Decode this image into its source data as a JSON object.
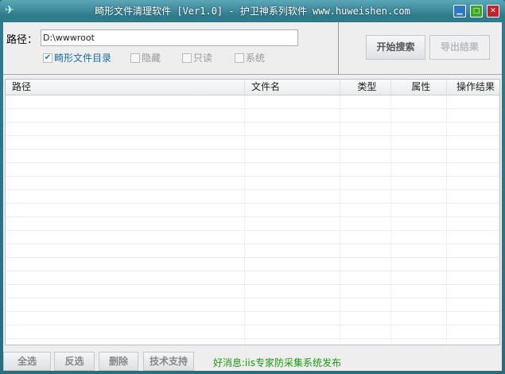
{
  "window": {
    "title": "畸形文件清理软件 [Ver1.0] - 护卫神系列软件 www.huweishen.com",
    "icon": "bird-logo-icon",
    "controls": [
      "minimize",
      "maximize",
      "close"
    ]
  },
  "path": {
    "label": "路径：",
    "value": "D:\\wwwroot"
  },
  "options": [
    {
      "label": "畸形文件目录",
      "checked": true
    },
    {
      "label": "隐藏",
      "checked": false
    },
    {
      "label": "只读",
      "checked": false
    },
    {
      "label": "系统",
      "checked": false
    }
  ],
  "actions": {
    "search": "开始搜索",
    "export": "导出结果"
  },
  "table": {
    "columns": [
      "路径",
      "文件名",
      "类型",
      "属性",
      "操作结果"
    ],
    "rows": []
  },
  "footer": {
    "select_all": "全选",
    "invert": "反选",
    "delete": "删除",
    "support": "技术支持",
    "news": "好消息:iis专家防采集系统发布"
  },
  "colors": {
    "frame": "#2f7b8c",
    "news": "#1a9a10",
    "checkbox": "#1a7fc0"
  }
}
